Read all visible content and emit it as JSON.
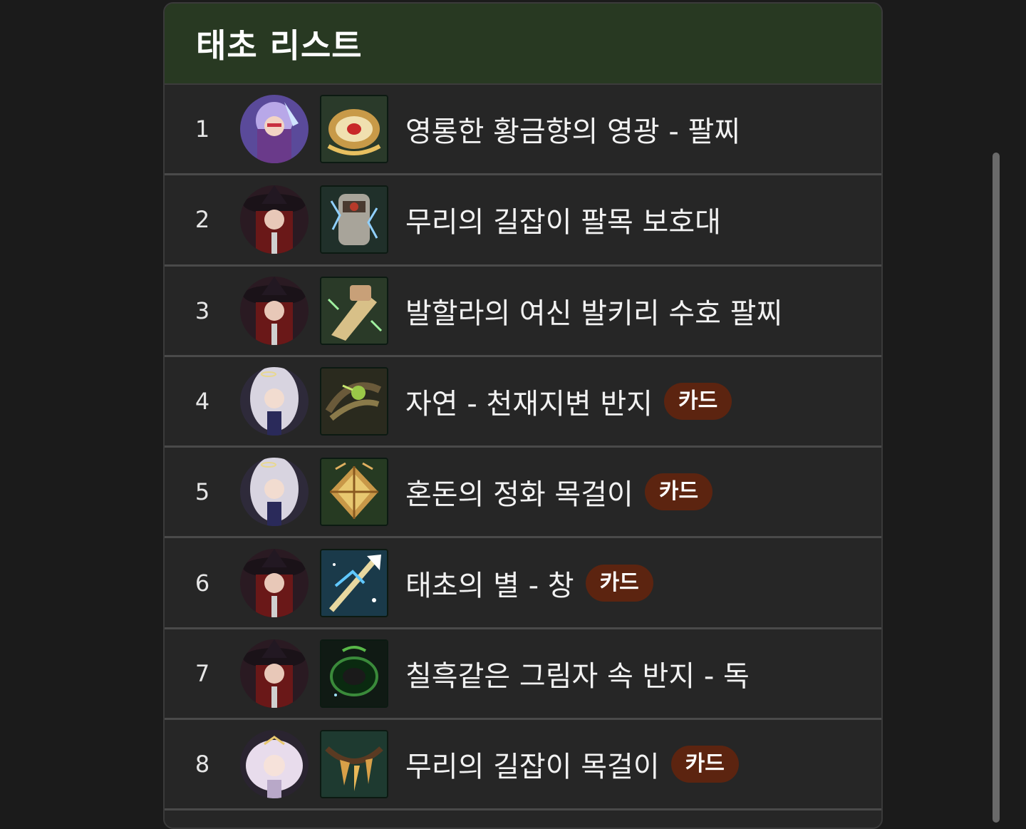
{
  "header": {
    "title": "태초 리스트"
  },
  "rows": [
    {
      "rank": "1",
      "name": "영롱한 황금향의 영광 - 팔찌",
      "badge": "",
      "avatar_icon": "character-lilac-knight-icon",
      "item_icon": "golden-bracelet-icon"
    },
    {
      "rank": "2",
      "name": "무리의 길잡이 팔목 보호대",
      "badge": "",
      "avatar_icon": "character-black-hat-icon",
      "item_icon": "wrist-guard-icon"
    },
    {
      "rank": "3",
      "name": "발할라의 여신 발키리 수호 팔찌",
      "badge": "",
      "avatar_icon": "character-black-hat-icon",
      "item_icon": "valkyrie-bracelet-icon"
    },
    {
      "rank": "4",
      "name": "자연 - 천재지변 반지",
      "badge": "카드",
      "avatar_icon": "character-white-hair-icon",
      "item_icon": "nature-ring-icon"
    },
    {
      "rank": "5",
      "name": "혼돈의 정화 목걸이",
      "badge": "카드",
      "avatar_icon": "character-white-hair-icon",
      "item_icon": "leaf-necklace-icon"
    },
    {
      "rank": "6",
      "name": "태초의 별 - 창",
      "badge": "카드",
      "avatar_icon": "character-black-hat-icon",
      "item_icon": "star-spear-icon"
    },
    {
      "rank": "7",
      "name": "칠흑같은 그림자 속 반지 - 독",
      "badge": "",
      "avatar_icon": "character-black-hat-icon",
      "item_icon": "shadow-ring-icon"
    },
    {
      "rank": "8",
      "name": "무리의 길잡이 목걸이",
      "badge": "카드",
      "avatar_icon": "character-pale-girl-icon",
      "item_icon": "fang-necklace-icon"
    }
  ],
  "colors": {
    "background": "#1b1b1b",
    "panel": "#262626",
    "header": "#283922",
    "badge": "#5c2410",
    "text": "#f2f2f2"
  }
}
